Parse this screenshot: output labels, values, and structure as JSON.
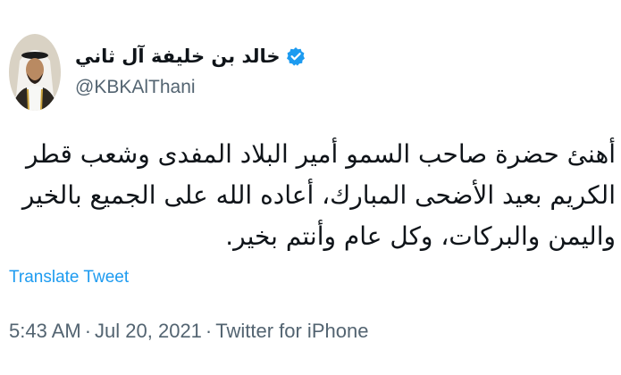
{
  "user": {
    "display_name": "خالد بن خليفة آل ثاني",
    "handle": "@KBKAlThani",
    "verified": true,
    "avatar_icon": "person-avatar"
  },
  "tweet": {
    "text": "أهنئ حضرة صاحب السمو أمير البلاد المفدى وشعب قطر\nالكريم بعيد الأضحى المبارك، أعاده الله على الجميع بالخير\nواليمن والبركات، وكل عام وأنتم بخير.",
    "translate_label": "Translate Tweet",
    "time": "5:43 AM",
    "separator": "·",
    "date": "Jul 20, 2021",
    "source": "Twitter for iPhone"
  },
  "colors": {
    "accent": "#1d9bf0",
    "text": "#0f1419",
    "secondary": "#536471"
  }
}
